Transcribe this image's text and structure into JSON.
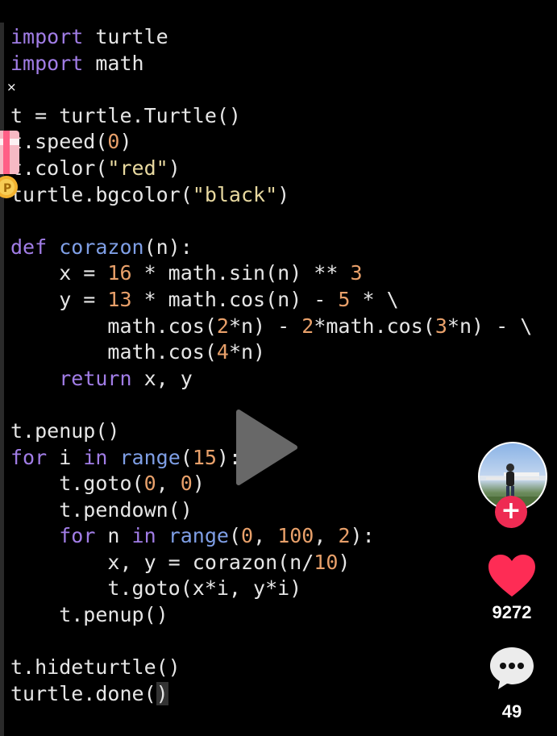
{
  "code_lines": [
    [
      {
        "t": "import",
        "c": "kw"
      },
      {
        "t": " turtle",
        "c": "tx"
      }
    ],
    [
      {
        "t": "import",
        "c": "kw"
      },
      {
        "t": " math",
        "c": "tx"
      }
    ],
    [],
    [
      {
        "t": "t = turtle.Turtle()",
        "c": "tx"
      }
    ],
    [
      {
        "t": "t.speed(",
        "c": "tx"
      },
      {
        "t": "0",
        "c": "num"
      },
      {
        "t": ")",
        "c": "tx"
      }
    ],
    [
      {
        "t": "t.color(",
        "c": "tx"
      },
      {
        "t": "\"red\"",
        "c": "str"
      },
      {
        "t": ")",
        "c": "tx"
      }
    ],
    [
      {
        "t": "turtle.bgcolor(",
        "c": "tx"
      },
      {
        "t": "\"black\"",
        "c": "str"
      },
      {
        "t": ")",
        "c": "tx"
      }
    ],
    [],
    [
      {
        "t": "def",
        "c": "kw"
      },
      {
        "t": " ",
        "c": "tx"
      },
      {
        "t": "corazon",
        "c": "fn"
      },
      {
        "t": "(n):",
        "c": "tx"
      }
    ],
    [
      {
        "t": "    x = ",
        "c": "tx"
      },
      {
        "t": "16",
        "c": "num"
      },
      {
        "t": " * math.sin(n) ** ",
        "c": "tx"
      },
      {
        "t": "3",
        "c": "num"
      }
    ],
    [
      {
        "t": "    y = ",
        "c": "tx"
      },
      {
        "t": "13",
        "c": "num"
      },
      {
        "t": " * math.cos(n) - ",
        "c": "tx"
      },
      {
        "t": "5",
        "c": "num"
      },
      {
        "t": " * \\",
        "c": "tx"
      }
    ],
    [
      {
        "t": "        math.cos(",
        "c": "tx"
      },
      {
        "t": "2",
        "c": "num"
      },
      {
        "t": "*n) - ",
        "c": "tx"
      },
      {
        "t": "2",
        "c": "num"
      },
      {
        "t": "*math.cos(",
        "c": "tx"
      },
      {
        "t": "3",
        "c": "num"
      },
      {
        "t": "*n) - \\",
        "c": "tx"
      }
    ],
    [
      {
        "t": "        math.cos(",
        "c": "tx"
      },
      {
        "t": "4",
        "c": "num"
      },
      {
        "t": "*n)",
        "c": "tx"
      }
    ],
    [
      {
        "t": "    ",
        "c": "tx"
      },
      {
        "t": "return",
        "c": "kw"
      },
      {
        "t": " x, y",
        "c": "tx"
      }
    ],
    [],
    [
      {
        "t": "t.penup()",
        "c": "tx"
      }
    ],
    [
      {
        "t": "for",
        "c": "kw"
      },
      {
        "t": " i ",
        "c": "tx"
      },
      {
        "t": "in",
        "c": "kw"
      },
      {
        "t": " ",
        "c": "tx"
      },
      {
        "t": "range",
        "c": "fn"
      },
      {
        "t": "(",
        "c": "tx"
      },
      {
        "t": "15",
        "c": "num"
      },
      {
        "t": "):",
        "c": "tx"
      }
    ],
    [
      {
        "t": "    t.goto(",
        "c": "tx"
      },
      {
        "t": "0",
        "c": "num"
      },
      {
        "t": ", ",
        "c": "tx"
      },
      {
        "t": "0",
        "c": "num"
      },
      {
        "t": ")",
        "c": "tx"
      }
    ],
    [
      {
        "t": "    t.pendown()",
        "c": "tx"
      }
    ],
    [
      {
        "t": "    ",
        "c": "tx"
      },
      {
        "t": "for",
        "c": "kw"
      },
      {
        "t": " n ",
        "c": "tx"
      },
      {
        "t": "in",
        "c": "kw"
      },
      {
        "t": " ",
        "c": "tx"
      },
      {
        "t": "range",
        "c": "fn"
      },
      {
        "t": "(",
        "c": "tx"
      },
      {
        "t": "0",
        "c": "num"
      },
      {
        "t": ", ",
        "c": "tx"
      },
      {
        "t": "100",
        "c": "num"
      },
      {
        "t": ", ",
        "c": "tx"
      },
      {
        "t": "2",
        "c": "num"
      },
      {
        "t": "):",
        "c": "tx"
      }
    ],
    [
      {
        "t": "        x, y = corazon(n/",
        "c": "tx"
      },
      {
        "t": "10",
        "c": "num"
      },
      {
        "t": ")",
        "c": "tx"
      }
    ],
    [
      {
        "t": "        t.goto(x*i, y*i)",
        "c": "tx"
      }
    ],
    [
      {
        "t": "    t.penup()",
        "c": "tx"
      }
    ],
    [],
    [
      {
        "t": "t.hideturtle()",
        "c": "tx"
      }
    ],
    [
      {
        "t": "turtle.done(",
        "c": "tx"
      },
      {
        "t": ")",
        "c": "caret-box"
      }
    ]
  ],
  "overlay": {
    "close_glyph": "×",
    "like_count": "9272",
    "comment_count": "49",
    "follow_glyph": "+"
  },
  "icons": {
    "close": "close-icon",
    "gift": "gift-icon",
    "play": "play-icon",
    "like": "heart-icon",
    "comment": "comment-bubble-icon",
    "follow": "plus-icon",
    "avatar": "creator-avatar"
  },
  "colors": {
    "keyword": "#a17de6",
    "function": "#7f9fe6",
    "number": "#e8a06a",
    "string": "#e8d9a0",
    "text": "#e6e6e6",
    "like": "#fe2c55",
    "follow": "#ee2b53"
  }
}
